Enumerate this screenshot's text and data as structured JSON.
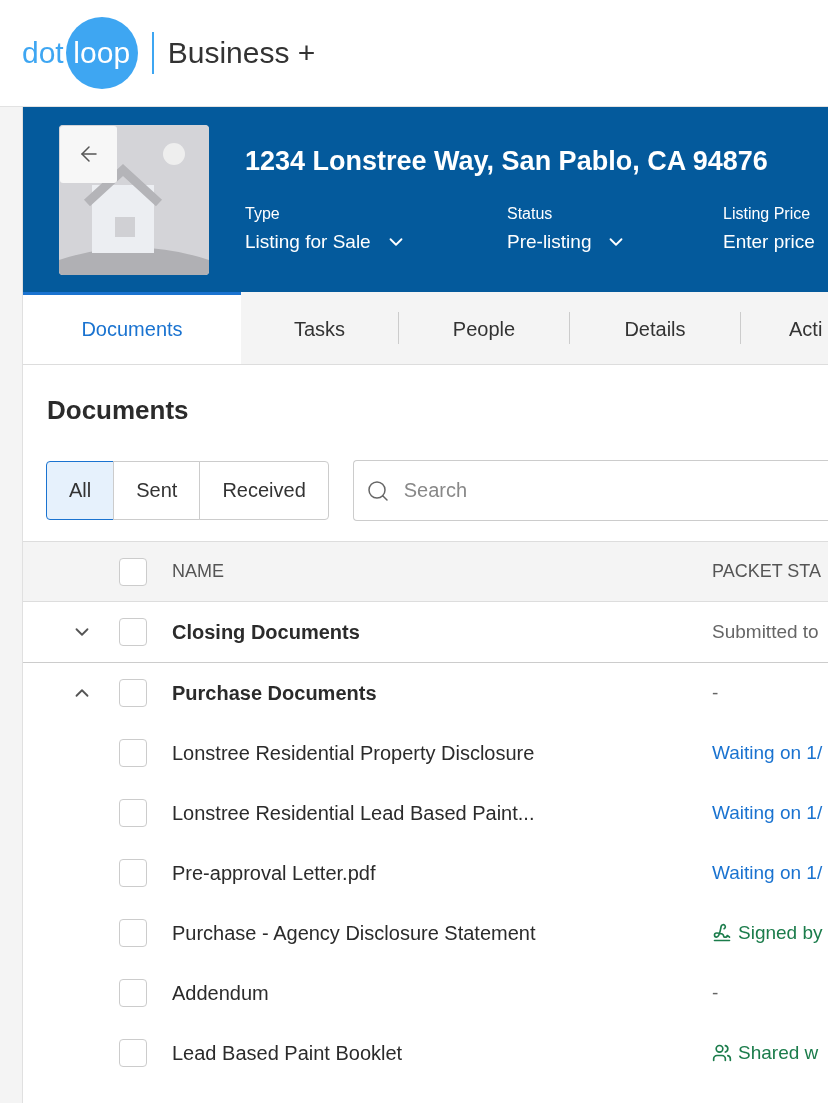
{
  "header": {
    "logo": {
      "left": "dot",
      "right": "loop"
    },
    "product": "Business +"
  },
  "loop": {
    "title": "1234 Lonstree Way, San Pablo, CA 94876",
    "fields": [
      {
        "label": "Type",
        "value": "Listing for Sale",
        "kind": "dropdown"
      },
      {
        "label": "Status",
        "value": "Pre-listing",
        "kind": "dropdown"
      },
      {
        "label": "Listing Price",
        "value": "Enter price",
        "kind": "input"
      }
    ]
  },
  "tabs": [
    {
      "label": "Documents",
      "selected": true
    },
    {
      "label": "Tasks",
      "selected": false
    },
    {
      "label": "People",
      "selected": false
    },
    {
      "label": "Details",
      "selected": false
    },
    {
      "label": "Acti",
      "selected": false
    }
  ],
  "section_title": "Documents",
  "filters": [
    {
      "label": "All",
      "selected": true
    },
    {
      "label": "Sent",
      "selected": false
    },
    {
      "label": "Received",
      "selected": false
    }
  ],
  "search": {
    "placeholder": "Search"
  },
  "table": {
    "columns": [
      "NAME",
      "PACKET STA"
    ],
    "header_checked": false,
    "rows": [
      {
        "name": "Closing Documents",
        "status": {
          "kind": "muted",
          "text": "Submitted to"
        },
        "checked": false,
        "expanded": false,
        "children": []
      },
      {
        "name": "Purchase Documents",
        "status": {
          "kind": "muted",
          "text": "-"
        },
        "checked": false,
        "expanded": true,
        "children": [
          {
            "name": "Lonstree Residential Property Disclosure",
            "status": {
              "kind": "waiting",
              "text": "Waiting on 1/"
            },
            "checked": false
          },
          {
            "name": "Lonstree Residential Lead Based Paint...",
            "status": {
              "kind": "waiting",
              "text": "Waiting on 1/"
            },
            "checked": false
          },
          {
            "name": "Pre-approval Letter.pdf",
            "status": {
              "kind": "waiting",
              "text": "Waiting on 1/"
            },
            "checked": false
          },
          {
            "name": "Purchase - Agency Disclosure Statement",
            "status": {
              "kind": "signed",
              "text": "Signed by"
            },
            "checked": false
          },
          {
            "name": "Addendum",
            "status": {
              "kind": "muted",
              "text": "-"
            },
            "checked": false
          },
          {
            "name": "Lead Based Paint Booklet",
            "status": {
              "kind": "shared",
              "text": "Shared w"
            },
            "checked": false
          }
        ]
      }
    ]
  }
}
